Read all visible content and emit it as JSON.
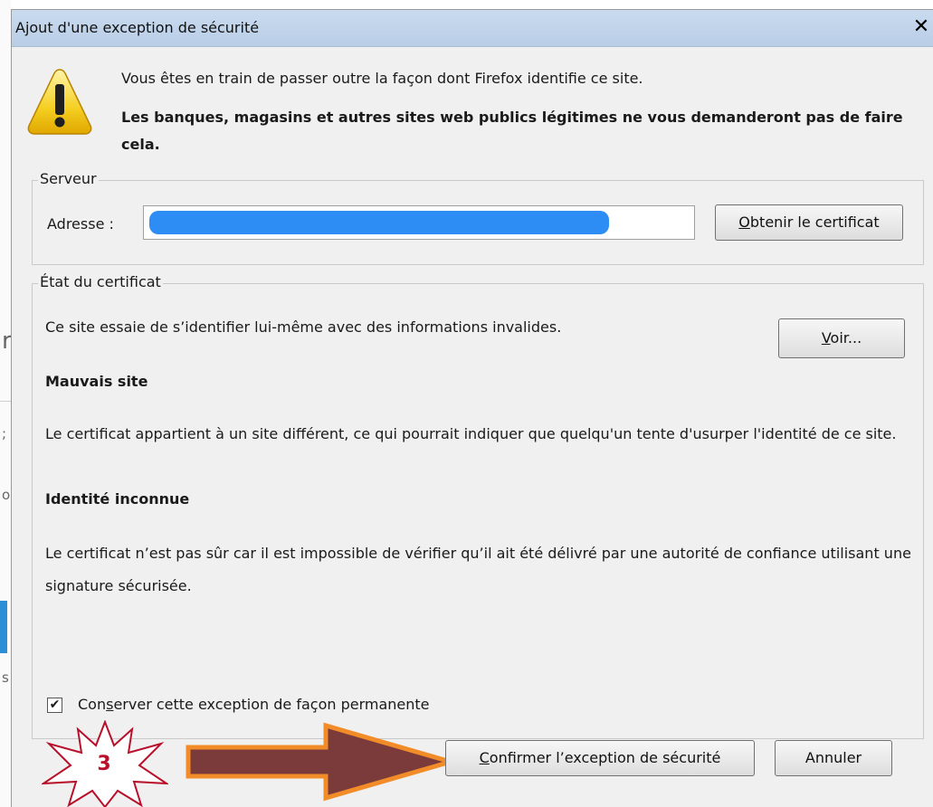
{
  "dialog": {
    "title": "Ajout d'une exception de sécurité",
    "close_symbol": "✕",
    "warning_icon": "warning-icon",
    "warning_line1": "Vous êtes en train de passer outre la façon dont Firefox identifie ce site.",
    "warning_line2": "Les banques, magasins et autres sites web publics légitimes ne vous demanderont pas de faire cela."
  },
  "server": {
    "legend": "Serveur",
    "address_label": "Adresse :",
    "address_value": "",
    "obtain_button": {
      "pre": "",
      "mnemonic": "O",
      "post": "btenir le certificat"
    }
  },
  "certificate": {
    "legend": "État du certificat",
    "description": "Ce site essaie de s’identifier lui-même avec des informations invalides.",
    "view_button": {
      "pre": "",
      "mnemonic": "V",
      "post": "oir..."
    },
    "wrong_site_heading": "Mauvais site",
    "wrong_site_text": "Le certificat appartient à un site différent, ce qui pourrait indiquer que quelqu'un tente d'usurper l'identité de ce site.",
    "unknown_identity_heading": "Identité inconnue",
    "unknown_identity_text": "Le certificat n’est pas sûr car il est impossible de vérifier qu’il ait été délivré par une autorité de confiance utilisant une signature sécurisée.",
    "permanent_checked": true,
    "permanent_label": {
      "pre": "Con",
      "mnemonic": "s",
      "post": "erver cette exception de façon permanente"
    }
  },
  "buttons": {
    "confirm": {
      "pre": "",
      "mnemonic": "C",
      "post": "onfirmer l’exception de sécurité"
    },
    "cancel": "Annuler"
  },
  "annotation": {
    "step_number": "3",
    "arrow_color": "#7b3b3b",
    "arrow_outline": "#f28c28",
    "star_color": "#b8102a"
  },
  "background": {
    "glyphs": [
      "r",
      ";",
      "o",
      "s"
    ]
  },
  "colors": {
    "titlebar": "#c4d7ed",
    "dialog_bg": "#f0f0f0",
    "redaction": "#2e8cf5"
  }
}
